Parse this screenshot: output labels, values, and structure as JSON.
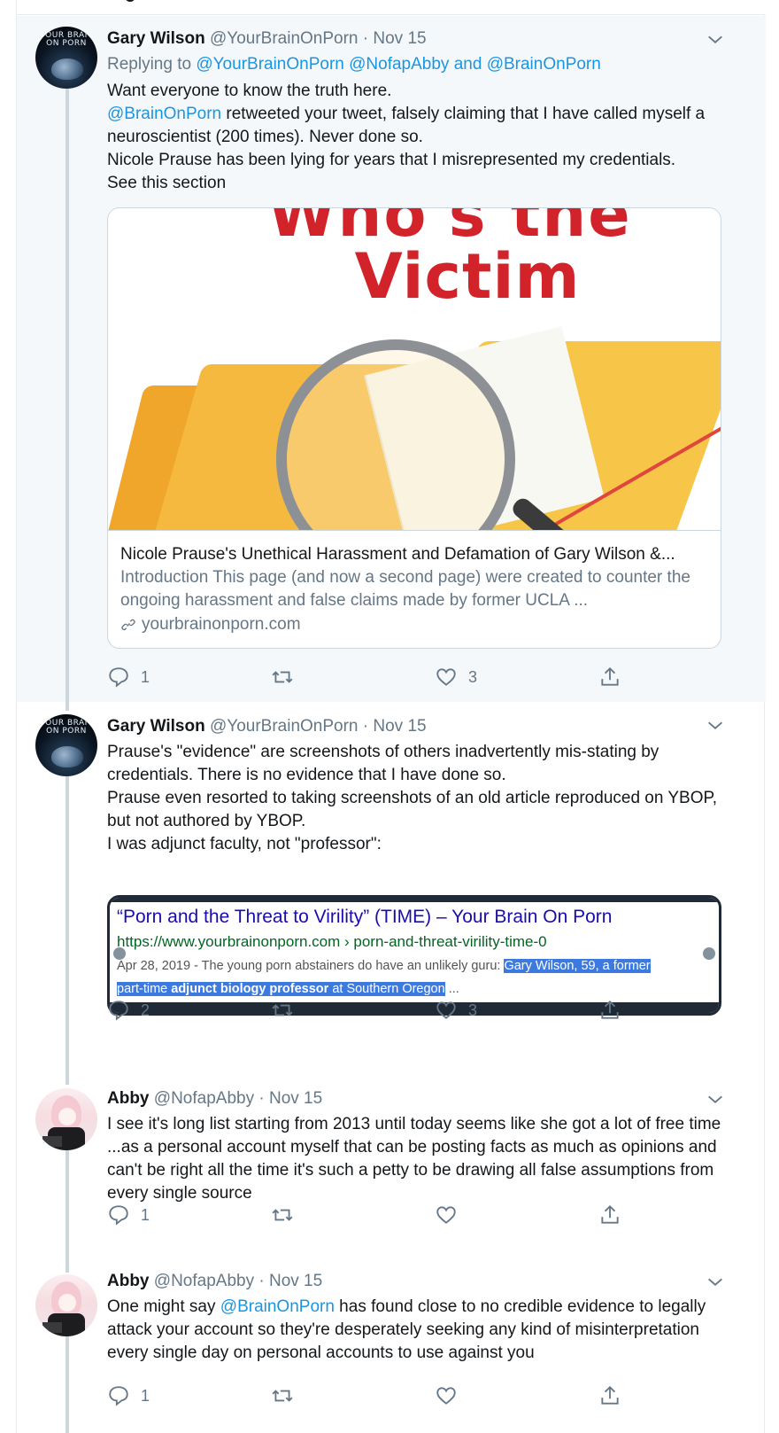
{
  "tweets": [
    {
      "name": "Gary Wilson",
      "handle": "@YourBrainOnPorn",
      "separator": "·",
      "date": "Nov 15",
      "replying_prefix": "Replying to",
      "replying_to": [
        "@YourBrainOnPorn",
        "@NofapAbby"
      ],
      "replying_and": "and",
      "replying_last": "@BrainOnPorn",
      "avatar": "brain-book-cover",
      "body": {
        "line1": "Want everyone to know the truth here.",
        "mention": "@BrainOnPorn",
        "line2_rest": " retweeted your tweet, falsely claiming that I have called myself a neuroscientist (200 times). Never done so.",
        "line3": "Nicole Prause has been lying for years that I misrepresented my credentials.",
        "line4": "See this section"
      },
      "card": {
        "image_text_top": "Who's the",
        "image_text_bottom": "Victim",
        "title": "Nicole Prause's Unethical Harassment and Defamation of Gary Wilson &...",
        "description": "Introduction This page (and now a second page) were created to counter the ongoing harassment and false claims made by former UCLA ...",
        "domain": "yourbrainonporn.com"
      },
      "replies": "1",
      "retweets": "",
      "likes": "3"
    },
    {
      "name": "Gary Wilson",
      "handle": "@YourBrainOnPorn",
      "separator": "·",
      "date": "Nov 15",
      "avatar": "brain-book-cover",
      "body": {
        "line1": "Prause's \"evidence\" are screenshots of others inadvertently mis-stating by credentials. There is no evidence that I have done so.",
        "line2": "Prause even resorted to taking screenshots of an old article reproduced on YBOP, but not authored by YBOP.",
        "line3": "I was adjunct faculty, not \"professor\":"
      },
      "search_result": {
        "title": "“Porn and the Threat to Virility” (TIME) – Your Brain On Porn",
        "url": "https://www.yourbrainonporn.com › porn-and-threat-virility-time-0",
        "snippet_plain": "Apr 28, 2019 - The young porn abstainers do have an unlikely guru: ",
        "snippet_hl1": "Gary Wilson, 59, a former",
        "snippet_hl2a": "part-time ",
        "snippet_hl2b": "adjunct biology professor",
        "snippet_hl2c": " at Southern Oregon",
        "snippet_end": " ..."
      },
      "replies": "2",
      "retweets": "",
      "likes": "3"
    },
    {
      "name": "Abby",
      "handle": "@NofapAbby",
      "separator": "·",
      "date": "Nov 15",
      "avatar": "anime-girl",
      "body": {
        "line1": "I see it's long list starting from 2013 until today seems like she got a lot of free time ...as a personal account myself that can be posting facts as much as opinions and can't be right all the time it's such a petty to be drawing all false assumptions from every single source"
      },
      "replies": "1",
      "retweets": "",
      "likes": ""
    },
    {
      "name": "Abby",
      "handle": "@NofapAbby",
      "separator": "·",
      "date": "Nov 15",
      "avatar": "anime-girl",
      "body": {
        "prefix": "One might say ",
        "mention": "@BrainOnPorn",
        "rest": " has found close to no credible evidence to legally attack your account so they're desperately seeking any kind of misinterpretation every single day on personal accounts to use against you"
      },
      "replies": "1",
      "retweets": "",
      "likes": ""
    }
  ],
  "icons": {
    "reply": "reply-icon",
    "retweet": "retweet-icon",
    "like": "heart-icon",
    "share": "share-icon",
    "more": "chevron-down-icon",
    "link": "link-icon"
  },
  "colors": {
    "link_blue": "#1b95e0",
    "secondary_gray": "#657786",
    "thread_line": "#ccd6dd",
    "highlight_bg": "#f5f8fa"
  }
}
